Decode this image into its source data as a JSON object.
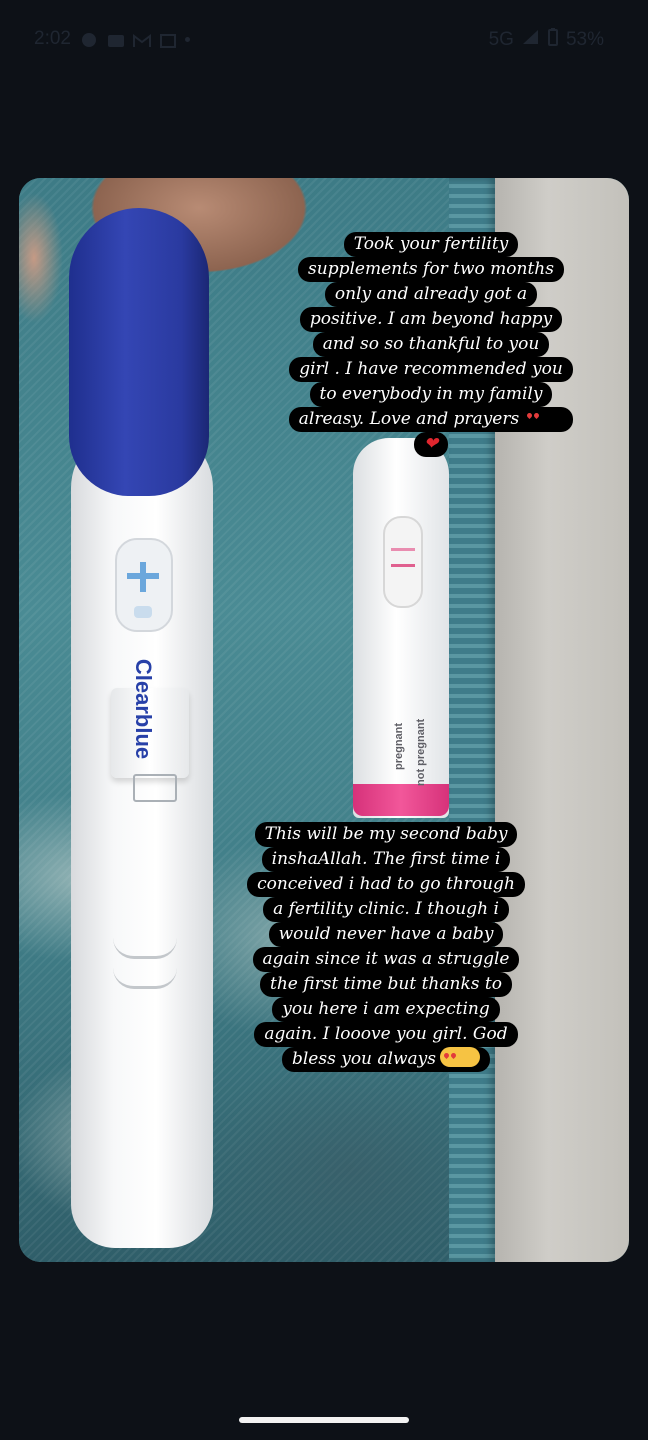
{
  "status_bar": {
    "time": "2:02",
    "network": "5G",
    "battery": "53%",
    "notification_icons": [
      "whatsapp-icon",
      "message-icon",
      "gmail-icon",
      "photos-icon"
    ]
  },
  "story": {
    "caption_top": {
      "lines": [
        "Took your fertility",
        "supplements for two months",
        "only and already got a",
        "positive. I am beyond happy",
        "and  so so thankful to you",
        "girl . I have recommended you",
        "to everybody in my family",
        "alreasy. Love and prayers"
      ],
      "emoji_after_last_line": "heart-eyes-emoji",
      "final_heart": "❤"
    },
    "caption_bottom": {
      "lines": [
        "This will be my second baby",
        "inshaAllah. The first time i",
        "conceived i had to go through",
        "a fertility clinic. I though i",
        "would never have a baby",
        "again since it was a struggle",
        "the first time but thanks to",
        "you here i am expecting",
        "again. I looove you girl. God",
        "bless you always"
      ],
      "emoji_after_last_line": "hugging-emoji"
    },
    "photo": {
      "test1_brand": "Clearblue",
      "test2_labels": [
        "pregnant",
        "not pregnant"
      ]
    }
  },
  "colors": {
    "background": "#0d1117",
    "caption_bg": "#000000",
    "caption_text": "#ffffff",
    "clearblue_cap": "#2f41aa",
    "test_tip": "#f2579a"
  }
}
